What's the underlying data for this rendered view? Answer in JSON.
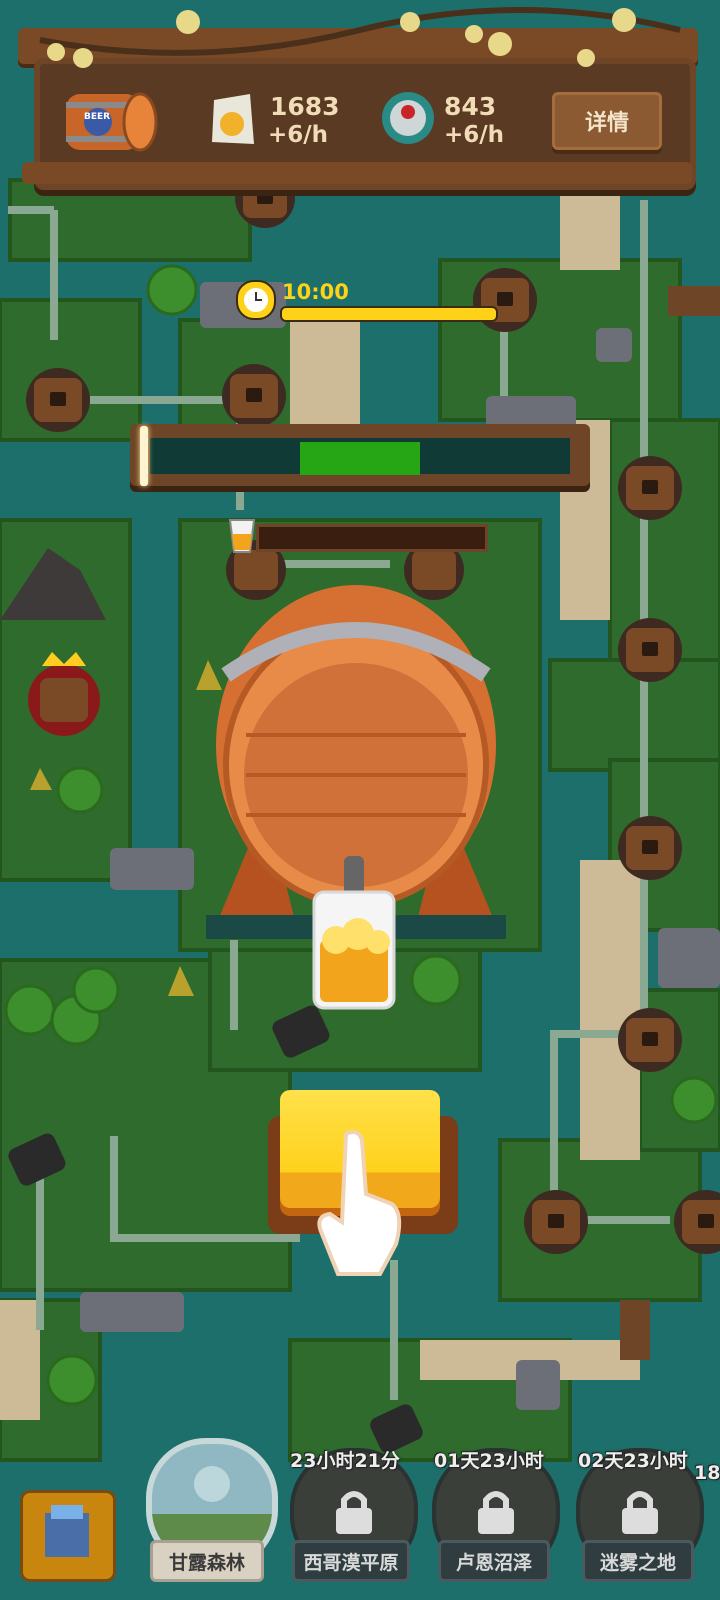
{
  "header": {
    "barrel_icon": "beer-barrel-icon",
    "beer_label": "BEER",
    "resource1": {
      "icon": "hops-bag-icon",
      "amount": "1683",
      "rate": "+6/h"
    },
    "resource2": {
      "icon": "bottle-cap-icon",
      "amount": "843",
      "rate": "+6/h"
    },
    "detail_label": "详情"
  },
  "timer": {
    "icon": "clock-icon",
    "time": "10:00"
  },
  "nav": [
    {
      "label": "甘露森林",
      "timer": "",
      "locked": false
    },
    {
      "label": "西哥漠平原",
      "timer": "23小时21分",
      "locked": true
    },
    {
      "label": "卢恩沼泽",
      "timer": "01天23小时",
      "locked": true
    },
    {
      "label": "迷雾之地",
      "timer": "02天23小时",
      "locked": true
    }
  ],
  "nav_edge_text": "18",
  "colors": {
    "accent": "#ffd11c",
    "zone": "#26a614",
    "wood": "#6e4526",
    "water": "#1c6f6a",
    "grass": "#2f6b2c"
  }
}
